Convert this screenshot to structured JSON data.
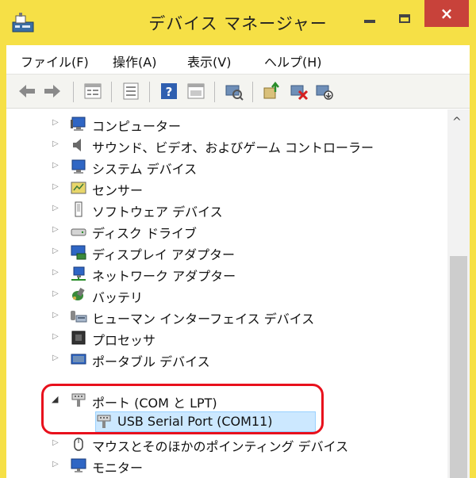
{
  "window": {
    "title": "デバイス マネージャー",
    "close_glyph": "×"
  },
  "menu": [
    "ファイル(F)",
    "操作(A)",
    "表示(V)",
    "ヘルプ(H)"
  ],
  "toolbar": {
    "icons": [
      "back-arrow-icon",
      "forward-arrow-icon",
      "properties-view-icon",
      "list-view-icon",
      "help-icon",
      "device-properties-icon",
      "scan-hardware-icon",
      "update-driver-icon",
      "uninstall-device-icon",
      "disable-device-icon"
    ]
  },
  "tree": {
    "items": [
      {
        "label": "コンピューター",
        "icon": "computer-icon",
        "expander": "▷"
      },
      {
        "label": "サウンド、ビデオ、およびゲーム コントローラー",
        "icon": "speaker-icon",
        "expander": "▷"
      },
      {
        "label": "システム デバイス",
        "icon": "system-device-icon",
        "expander": "▷"
      },
      {
        "label": "センサー",
        "icon": "sensor-icon",
        "expander": "▷"
      },
      {
        "label": "ソフトウェア デバイス",
        "icon": "software-device-icon",
        "expander": "▷"
      },
      {
        "label": "ディスク ドライブ",
        "icon": "disk-drive-icon",
        "expander": "▷"
      },
      {
        "label": "ディスプレイ アダプター",
        "icon": "display-adapter-icon",
        "expander": "▷"
      },
      {
        "label": "ネットワーク アダプター",
        "icon": "network-adapter-icon",
        "expander": "▷"
      },
      {
        "label": "バッテリ",
        "icon": "battery-icon",
        "expander": "▷"
      },
      {
        "label": "ヒューマン インターフェイス デバイス",
        "icon": "hid-icon",
        "expander": "▷"
      },
      {
        "label": "プロセッサ",
        "icon": "processor-icon",
        "expander": "▷"
      },
      {
        "label": "ポータブル デバイス",
        "icon": "portable-device-icon",
        "expander": "▷"
      },
      {
        "label": "ポート (COM と LPT)",
        "icon": "port-icon",
        "expander": "◢"
      },
      {
        "label": "USB Serial Port (COM11)",
        "icon": "port-icon",
        "selected": true
      },
      {
        "label": "マウスとそのほかのポインティング デバイス",
        "icon": "mouse-icon",
        "expander": "▷"
      },
      {
        "label": "モニター",
        "icon": "monitor-icon",
        "expander": "▷"
      }
    ]
  },
  "scrollbar": {
    "up_glyph": "^"
  },
  "colors": {
    "titlebar": "#f6e046",
    "close": "#c8423a",
    "selection": "#cce8ff",
    "annotation": "#e8101c"
  }
}
